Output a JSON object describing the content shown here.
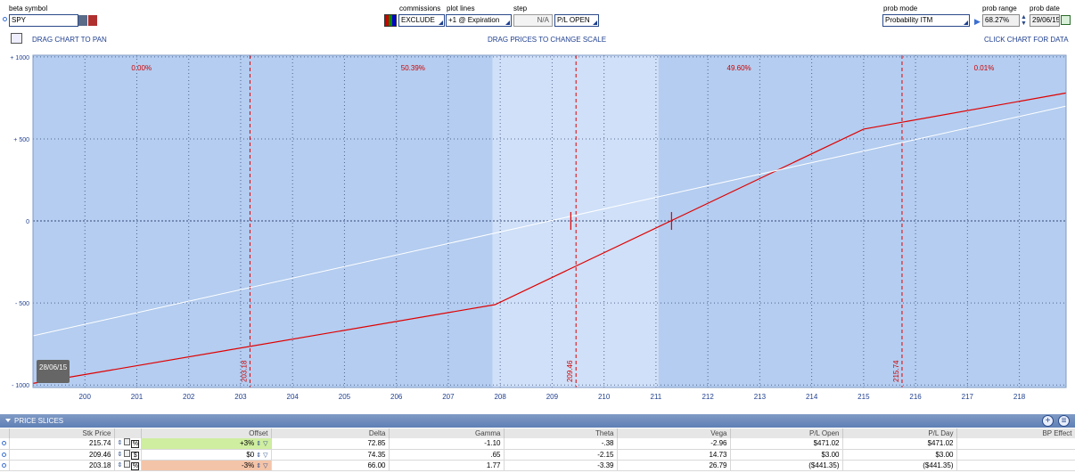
{
  "toolbar": {
    "beta_symbol_label": "beta symbol",
    "symbol_value": "SPY",
    "commissions_label": "commissions",
    "commissions_value": "EXCLUDE",
    "plot_lines_label": "plot lines",
    "plot_lines_value": "+1 @ Expiration",
    "step_label": "step",
    "step_value": "N/A",
    "pl_mode_value": "P/L OPEN",
    "prob_mode_label": "prob mode",
    "prob_mode_value": "Probability ITM",
    "prob_range_label": "prob range",
    "prob_range_value": "68.27%",
    "prob_date_label": "prob date",
    "prob_date_value": "29/06/15"
  },
  "hints": {
    "pan": "DRAG CHART TO PAN",
    "scale": "DRAG PRICES TO CHANGE SCALE",
    "data": "CLICK CHART FOR DATA"
  },
  "chart_data": {
    "type": "line",
    "x_ticks": [
      200,
      201,
      202,
      203,
      204,
      205,
      206,
      207,
      208,
      209,
      210,
      211,
      212,
      213,
      214,
      215,
      216,
      217,
      218
    ],
    "y_ticks": [
      {
        "value": 1000,
        "label": "+ 1000"
      },
      {
        "value": 500,
        "label": "+ 500"
      },
      {
        "value": 0,
        "label": "0"
      },
      {
        "value": -500,
        "label": "- 500"
      },
      {
        "value": -1000,
        "label": "- 1000"
      }
    ],
    "xlim": [
      199.0,
      218.9
    ],
    "ylim": [
      -1015,
      1010
    ],
    "grid": true,
    "probability_zones": [
      {
        "from": 199.0,
        "to": 203.18,
        "label": "0.00%"
      },
      {
        "from": 203.18,
        "to": 209.46,
        "label": "50.39%"
      },
      {
        "from": 209.46,
        "to": 215.74,
        "label": "49.60%"
      },
      {
        "from": 215.74,
        "to": 218.9,
        "label": "0.01%"
      }
    ],
    "std_dev_band": [
      207.85,
      211.05
    ],
    "price_markers": [
      {
        "x": 203.18,
        "label": "203.18"
      },
      {
        "x": 209.46,
        "label": "209.46"
      },
      {
        "x": 215.74,
        "label": "215.74"
      }
    ],
    "series": [
      {
        "type": "expiration",
        "color": "#e00000",
        "points": [
          [
            199.0,
            -990
          ],
          [
            207.9,
            -510
          ],
          [
            215.0,
            560
          ],
          [
            218.9,
            780
          ]
        ]
      },
      {
        "type": "today",
        "color": "#ffffff",
        "points": [
          [
            199.0,
            -700
          ],
          [
            218.9,
            700
          ]
        ]
      }
    ],
    "breakeven_markers": [
      209.36,
      211.3
    ],
    "date_tag": "28/06/15",
    "colors": {
      "background": "#b4cdf0",
      "band": "#cfe0f8",
      "grid": "#2a3a6a",
      "zone_line": "#e00000",
      "axis_text": "#1f3f8f",
      "zone_text": "#d00000"
    }
  },
  "price_slices": {
    "title": "PRICE SLICES",
    "add_icon": "plus-icon",
    "menu_icon": "list-icon",
    "columns": [
      "Stk Price",
      "Offset",
      "Delta",
      "Gamma",
      "Theta",
      "Vega",
      "P/L Open",
      "P/L Day",
      "BP Effect"
    ],
    "rows": [
      {
        "stk_price": "215.74",
        "offset": "+3%",
        "offset_tone": "pos",
        "delta": "72.85",
        "gamma": "-1.10",
        "theta": "-.38",
        "vega": "-2.96",
        "pl_open": "$471.02",
        "pl_day": "$471.02",
        "bp_effect": ""
      },
      {
        "stk_price": "209.46",
        "offset": "$0",
        "offset_tone": "zero",
        "delta": "74.35",
        "gamma": ".65",
        "theta": "-2.15",
        "vega": "14.73",
        "pl_open": "$3.00",
        "pl_day": "$3.00",
        "bp_effect": ""
      },
      {
        "stk_price": "203.18",
        "offset": "-3%",
        "offset_tone": "neg",
        "delta": "66.00",
        "gamma": "1.77",
        "theta": "-3.39",
        "vega": "26.79",
        "pl_open": "($441.35)",
        "pl_day": "($441.35)",
        "bp_effect": ""
      }
    ],
    "row_icon_labels": [
      "%",
      "$",
      "%"
    ]
  }
}
